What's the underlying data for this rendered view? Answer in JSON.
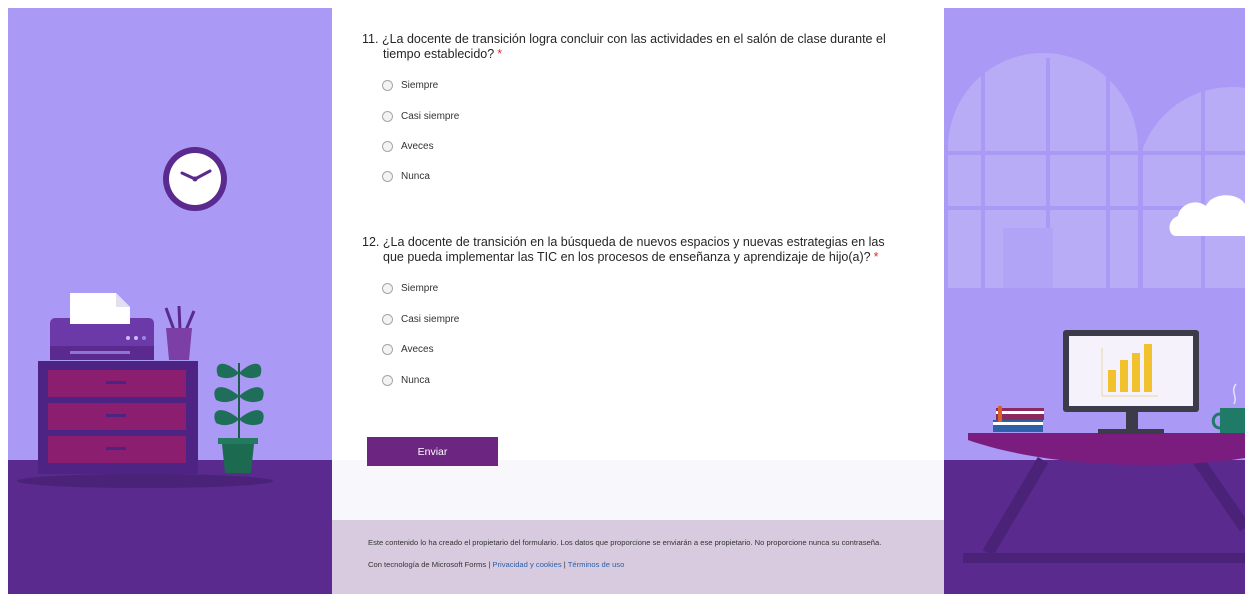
{
  "questions": [
    {
      "number": "11.",
      "title": "¿La docente de transición logra concluir con las actividades en el salón de clase durante el tiempo establecido?",
      "required_mark": "*",
      "options": [
        "Siempre",
        "Casi siempre",
        "Aveces",
        "Nunca"
      ]
    },
    {
      "number": "12.",
      "title": "¿La docente de transición en la búsqueda de nuevos espacios y nuevas estrategias en las que pueda implementar las TIC en los procesos de enseñanza y aprendizaje de hijo(a)?",
      "required_mark": "*",
      "options": [
        "Siempre",
        "Casi siempre",
        "Aveces",
        "Nunca"
      ]
    }
  ],
  "submit_label": "Enviar",
  "footer": {
    "disclaimer": "Este contenido lo ha creado el propietario del formulario. Los datos que proporcione se enviarán a ese propietario. No proporcione nunca su contraseña.",
    "powered_by": "Con tecnología de Microsoft Forms",
    "separator": "|",
    "privacy_link": "Privacidad y cookies",
    "terms_link": "Términos de uso"
  },
  "colors": {
    "theme_purple": "#ab9af5",
    "dark_purple": "#5b2c8c",
    "button": "#6c2581",
    "required": "#d13438",
    "footer_bg": "#d8cbdf",
    "link": "#2b5fa8"
  },
  "icons": [
    "clock-icon",
    "printer-icon",
    "plant-icon",
    "pencil-cup-icon",
    "window-icon",
    "cloud-icon",
    "monitor-chart-icon",
    "books-icon",
    "mug-icon"
  ]
}
